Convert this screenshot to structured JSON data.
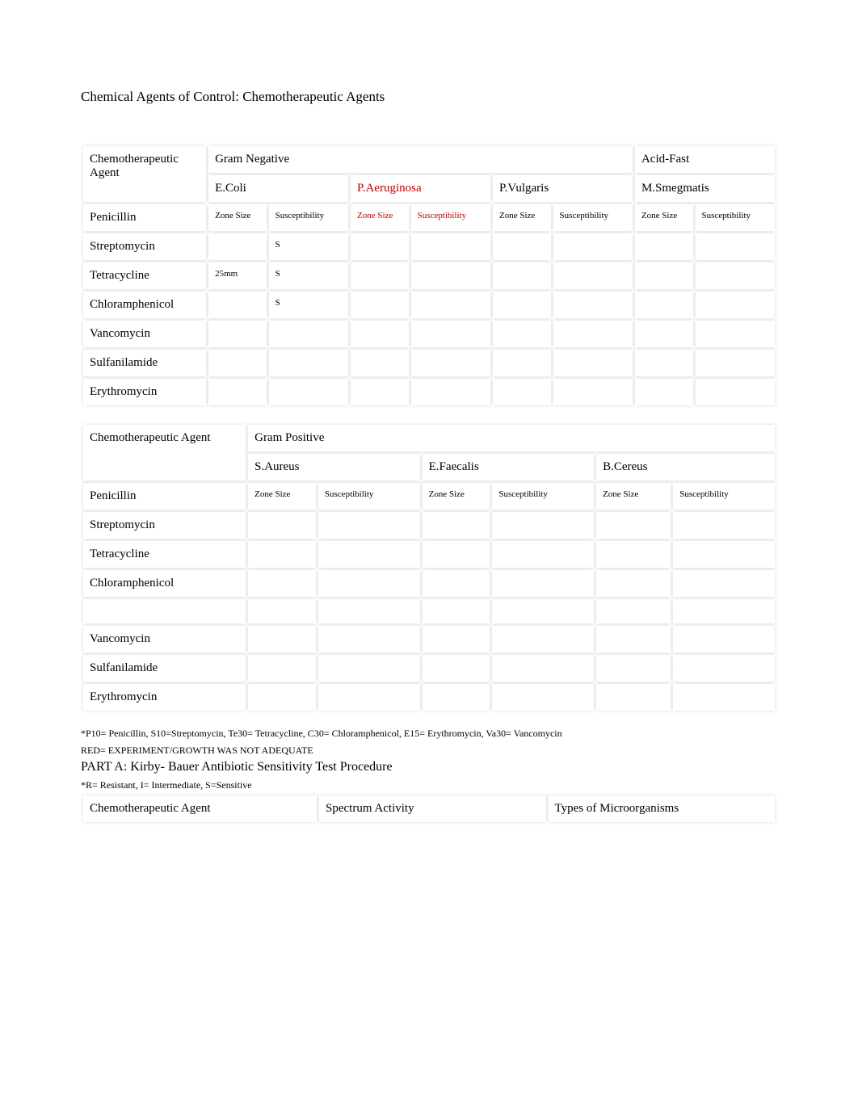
{
  "title": "Chemical Agents of Control: Chemotherapeutic Agents",
  "table1": {
    "agentHeader": "Chemotherapeutic Agent",
    "group1": "Gram Negative",
    "group2": "Acid-Fast",
    "organisms": {
      "ecoli": "E.Coli",
      "paeruginosa": "P.Aeruginosa",
      "pvulgaris": "P.Vulgaris",
      "msmegmatis": "M.Smegmatis"
    },
    "subheaders": {
      "zone": "Zone Size",
      "suscept": "Susceptibility"
    },
    "rows": [
      {
        "name": "Penicillin",
        "ecoli_zone": "Zone Size",
        "ecoli_susc": "Susceptibility",
        "pa_zone": "Zone Size",
        "pa_susc": "Susceptibility",
        "pv_zone": "Zone Size",
        "pv_susc": "Susceptibility",
        "ms_zone": "Zone Size",
        "ms_susc": "Susceptibility",
        "isHeaderRow": true
      },
      {
        "name": "Streptomycin",
        "ecoli_zone": "",
        "ecoli_susc": "S",
        "pa_zone": "",
        "pa_susc": "",
        "pv_zone": "",
        "pv_susc": "",
        "ms_zone": "",
        "ms_susc": ""
      },
      {
        "name": "Tetracycline",
        "ecoli_zone": "25mm",
        "ecoli_susc": "S",
        "pa_zone": "",
        "pa_susc": "",
        "pv_zone": "",
        "pv_susc": "",
        "ms_zone": "",
        "ms_susc": ""
      },
      {
        "name": "Chloramphenicol",
        "ecoli_zone": "",
        "ecoli_susc": "S",
        "pa_zone": "",
        "pa_susc": "",
        "pv_zone": "",
        "pv_susc": "",
        "ms_zone": "",
        "ms_susc": ""
      },
      {
        "name": "Vancomycin",
        "ecoli_zone": "",
        "ecoli_susc": "",
        "pa_zone": "",
        "pa_susc": "",
        "pv_zone": "",
        "pv_susc": "",
        "ms_zone": "",
        "ms_susc": ""
      },
      {
        "name": "Sulfanilamide",
        "ecoli_zone": "",
        "ecoli_susc": "",
        "pa_zone": "",
        "pa_susc": "",
        "pv_zone": "",
        "pv_susc": "",
        "ms_zone": "",
        "ms_susc": ""
      },
      {
        "name": "Erythromycin",
        "ecoli_zone": "",
        "ecoli_susc": "",
        "pa_zone": "",
        "pa_susc": "",
        "pv_zone": "",
        "pv_susc": "",
        "ms_zone": "",
        "ms_susc": ""
      }
    ]
  },
  "table2": {
    "agentHeader": "Chemotherapeutic Agent",
    "group": "Gram Positive",
    "organisms": {
      "saureus": "S.Aureus",
      "efaecalis": "E.Faecalis",
      "bcereus": "B.Cereus"
    },
    "subheaders": {
      "zone": "Zone Size",
      "suscept": "Susceptibility"
    },
    "rows": [
      {
        "name": "Penicillin",
        "sa_zone": "Zone Size",
        "sa_susc": "Susceptibility",
        "ef_zone": "Zone Size",
        "ef_susc": "Susceptibility",
        "bc_zone": "Zone Size",
        "bc_susc": "Susceptibility",
        "isHeaderRow": true
      },
      {
        "name": "Streptomycin"
      },
      {
        "name": "Tetracycline"
      },
      {
        "name": "Chloramphenicol"
      },
      {
        "name": "",
        "blank": true
      },
      {
        "name": "Vancomycin"
      },
      {
        "name": "Sulfanilamide"
      },
      {
        "name": "Erythromycin"
      }
    ]
  },
  "footnotes": {
    "codes": "*P10= Penicillin,  S10=Streptomycin, Te30= Tetracycline, C30= Chloramphenicol, E15= Erythromycin, Va30= Vancomycin",
    "red": "RED= EXPERIMENT/GROWTH WAS NOT ADEQUATE",
    "partA": "PART A: Kirby- Bauer Antibiotic Sensitivity Test Procedure",
    "legend": "*R= Resistant, I= Intermediate, S=Sensitive"
  },
  "table3": {
    "headers": {
      "agent": "Chemotherapeutic Agent",
      "spectrum": "Spectrum Activity",
      "types": "Types of Microorganisms"
    }
  }
}
